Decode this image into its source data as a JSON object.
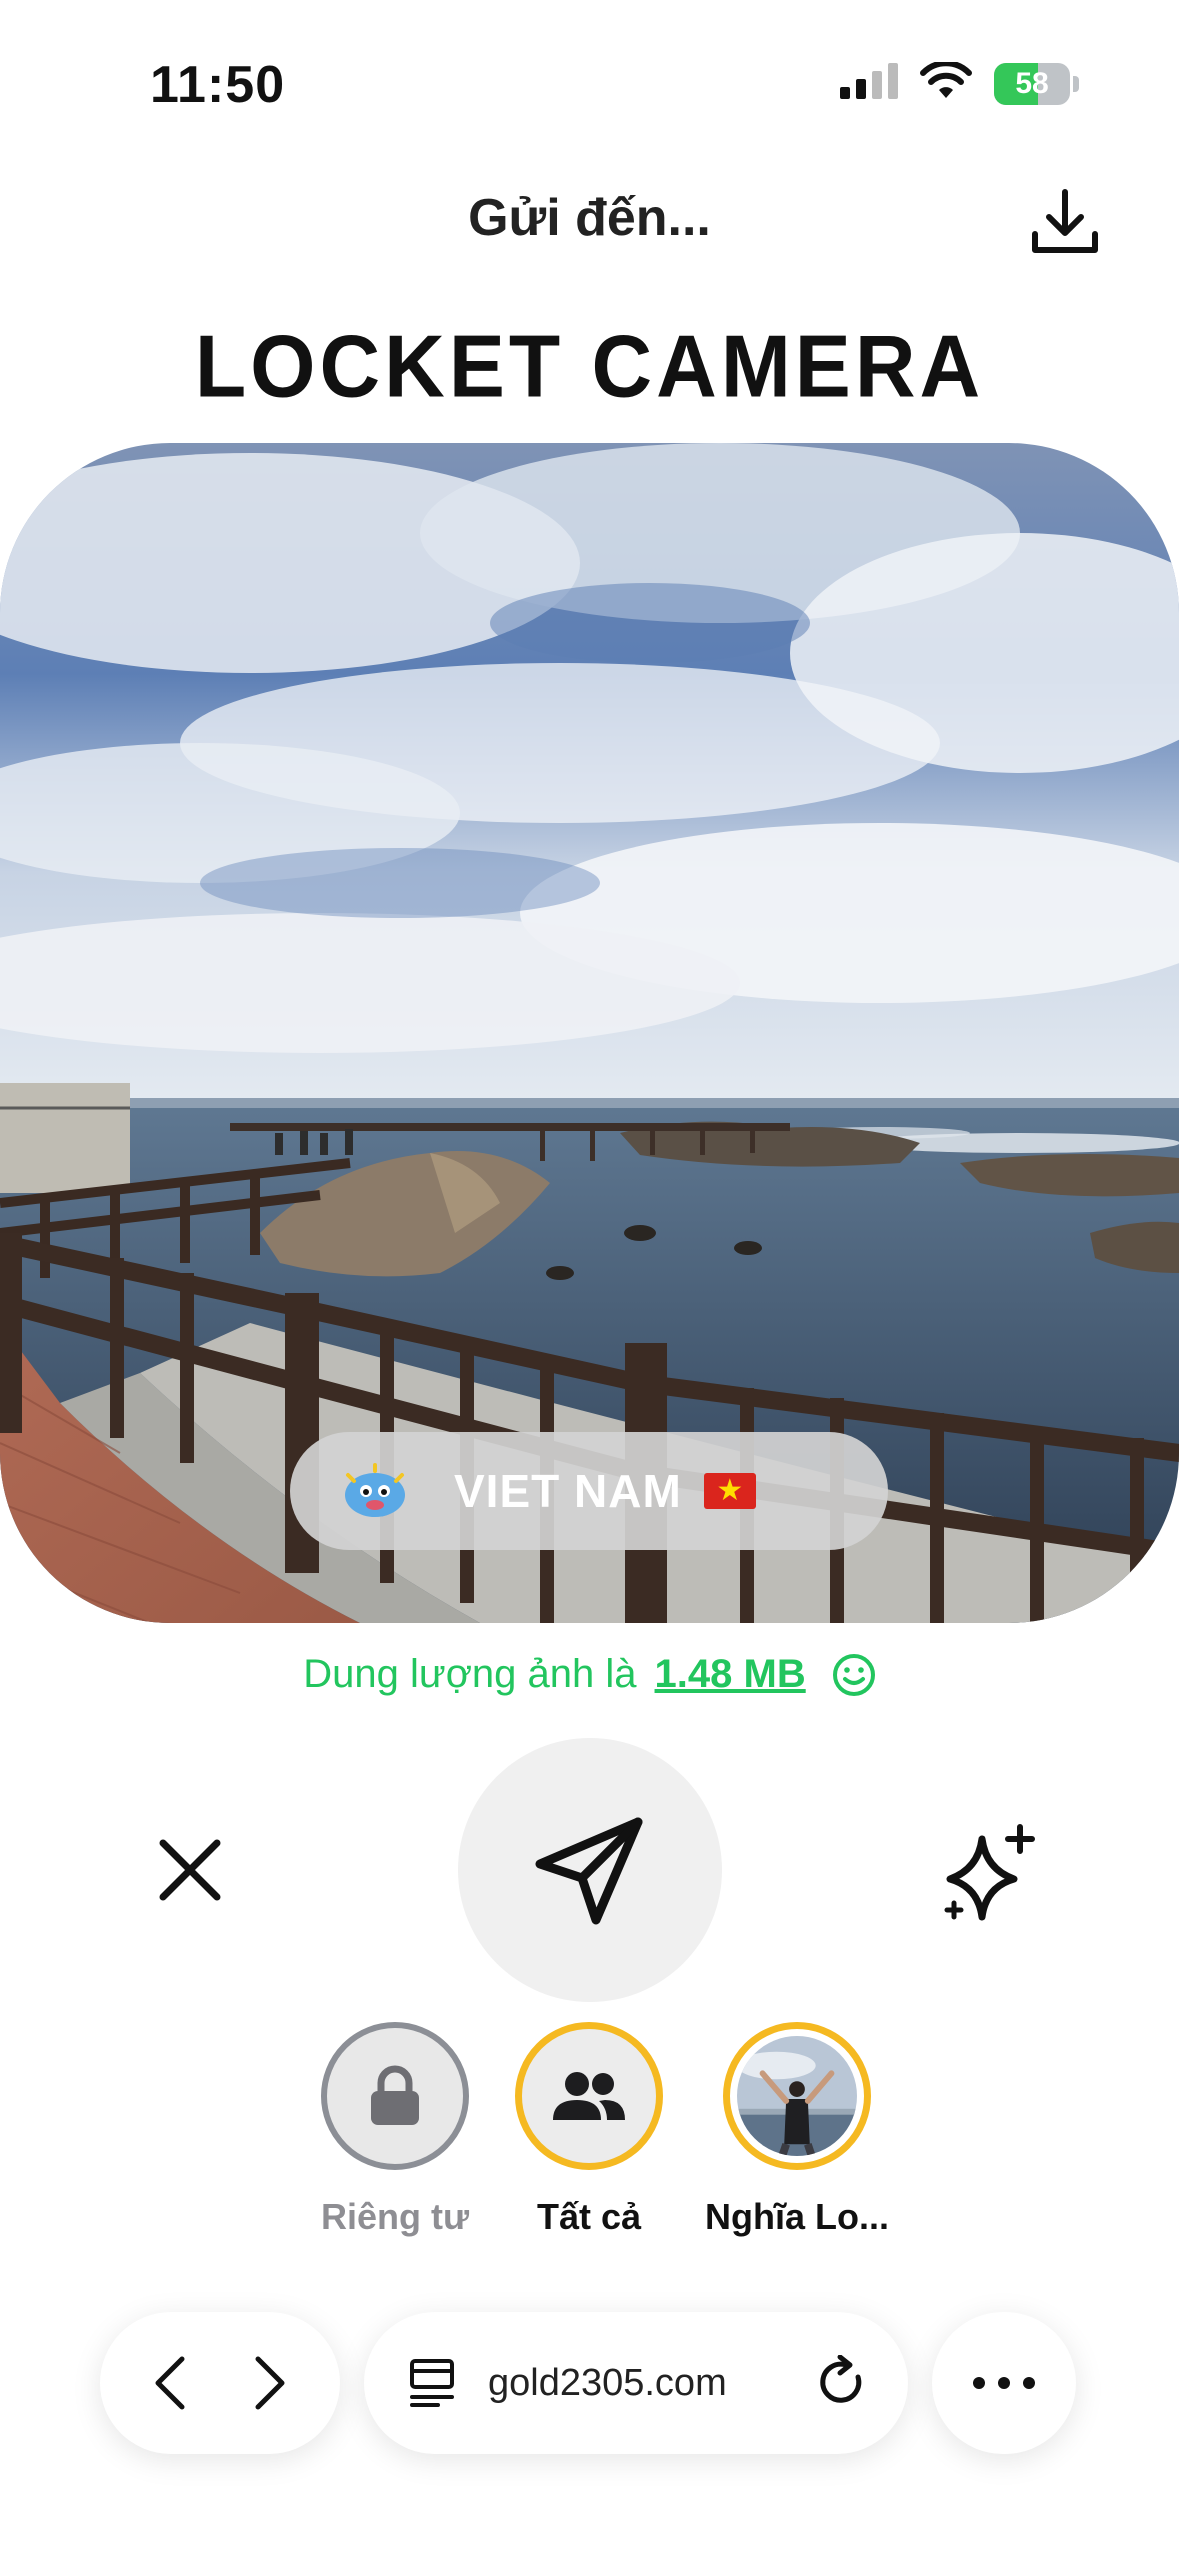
{
  "status_bar": {
    "time": "11:50",
    "battery": "58",
    "battery_level": 0.58
  },
  "header": {
    "title": "Gửi đến...",
    "app_title": "LOCKET CAMERA",
    "download_icon": "download-icon"
  },
  "photo": {
    "caption": "VIET NAM",
    "caption_flag": "vietnam-flag",
    "caption_sticker": "mascot-sticker"
  },
  "size_note": {
    "prefix": "Dung lượng ảnh là",
    "value": "1.48 MB",
    "icon": "smile-icon",
    "color": "#22c55e"
  },
  "actions": {
    "close_icon": "close-icon",
    "send_icon": "send-icon",
    "effects_icon": "sparkle-icon"
  },
  "recipients": [
    {
      "label": "Riêng tư",
      "icon": "lock-icon"
    },
    {
      "label": "Tất cả",
      "icon": "group-icon"
    },
    {
      "label": "Nghĩa Lo...",
      "icon": "avatar"
    }
  ],
  "browser": {
    "url": "gold2305.com",
    "back_icon": "chevron-left-icon",
    "forward_icon": "chevron-right-icon",
    "tabs_icon": "page-menu-icon",
    "reload_icon": "reload-icon",
    "more_icon": "more-icon"
  },
  "colors": {
    "accent_ring": "#f5b921",
    "success": "#22c55e",
    "muted": "#8e8e93"
  }
}
